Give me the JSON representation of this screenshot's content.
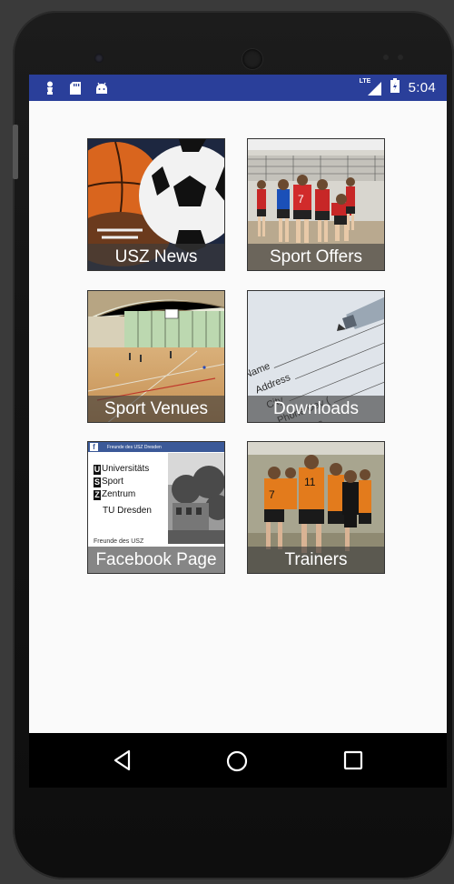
{
  "status_bar": {
    "time": "5:04",
    "network": "LTE",
    "icons": [
      "figure-icon",
      "sd-card-icon",
      "android-icon",
      "signal-icon",
      "battery-icon"
    ]
  },
  "tiles": [
    {
      "label": "USZ News",
      "image": "sports-balls-image"
    },
    {
      "label": "Sport Offers",
      "image": "volleyball-team-image"
    },
    {
      "label": "Sport Venues",
      "image": "sports-hall-image"
    },
    {
      "label": "Downloads",
      "image": "form-pen-image"
    },
    {
      "label": "Facebook Page",
      "image": "facebook-page-image",
      "fb_header": "Freunde des USZ Dresden",
      "logo_lines": [
        "Universitäts",
        "Sport",
        "Zentrum",
        "TU Dresden"
      ],
      "footer_text": "Freunde des USZ"
    },
    {
      "label": "Trainers",
      "image": "trainers-team-image"
    }
  ],
  "nav_bar": {
    "buttons": [
      "back",
      "home",
      "recents"
    ]
  },
  "colors": {
    "status_bar": "#2a3f9a",
    "nav_bar": "#000000",
    "caption_bg": "rgba(60,60,60,0.62)"
  }
}
